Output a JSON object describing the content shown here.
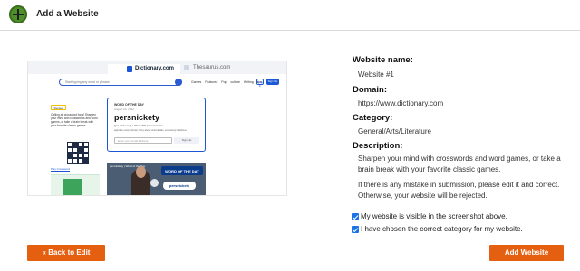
{
  "header": {
    "title": "Add a Website",
    "icon": "add-circle-icon"
  },
  "preview": {
    "tab_active": "Dictionary.com",
    "tab_inactive": "Thesaurus.com",
    "search_placeholder": "Start typing any word or phrase",
    "nav_links": "Games Featured Pop culture Writing tips",
    "login": "Log in",
    "signup": "Sign Up",
    "review_badge": "Review",
    "review_text": "Calling all crossword fans! Sharpen your mind with crosswords and word games, or take a brain break with your favorite classic games.",
    "play_link": "Play Crossword",
    "wotd_label": "WORD OF THE DAY",
    "wotd_date": "August 24, 2022",
    "wotd_word": "persnickety",
    "wotd_pron": "[per-snik-i-tee] ▸ Show IPA pronunciation",
    "wotd_def": "adjective overparticular; fussy about small details, excessively fastidious",
    "email_placeholder": "Enter your email address",
    "signup_btn": "Sign Up",
    "video_title": "persnickety | Word of the Day",
    "video_banner": "WORD OF THE DAY",
    "video_word": "persnickety"
  },
  "details": {
    "name_label": "Website name:",
    "name_value": "Website #1",
    "domain_label": "Domain:",
    "domain_value": "https://www.dictionary.com",
    "category_label": "Category:",
    "category_value": "General/Arts/Literature",
    "description_label": "Description:",
    "description_text": "Sharpen your mind with crosswords and word games, or take a brain break with your favorite classic games.",
    "notice_text": "If there is any mistake in submission, please edit it and correct. Otherwise, your website will be rejected."
  },
  "checks": [
    {
      "label": "My website is visible in the screenshot above.",
      "checked": true
    },
    {
      "label": "I have chosen the correct category for my website.",
      "checked": true
    }
  ],
  "actions": {
    "back_label": "« Back to Edit",
    "add_label": "Add Website"
  },
  "colors": {
    "accent": "#e55f10",
    "check": "#1a73e8",
    "plus": "#4f8f2a"
  }
}
